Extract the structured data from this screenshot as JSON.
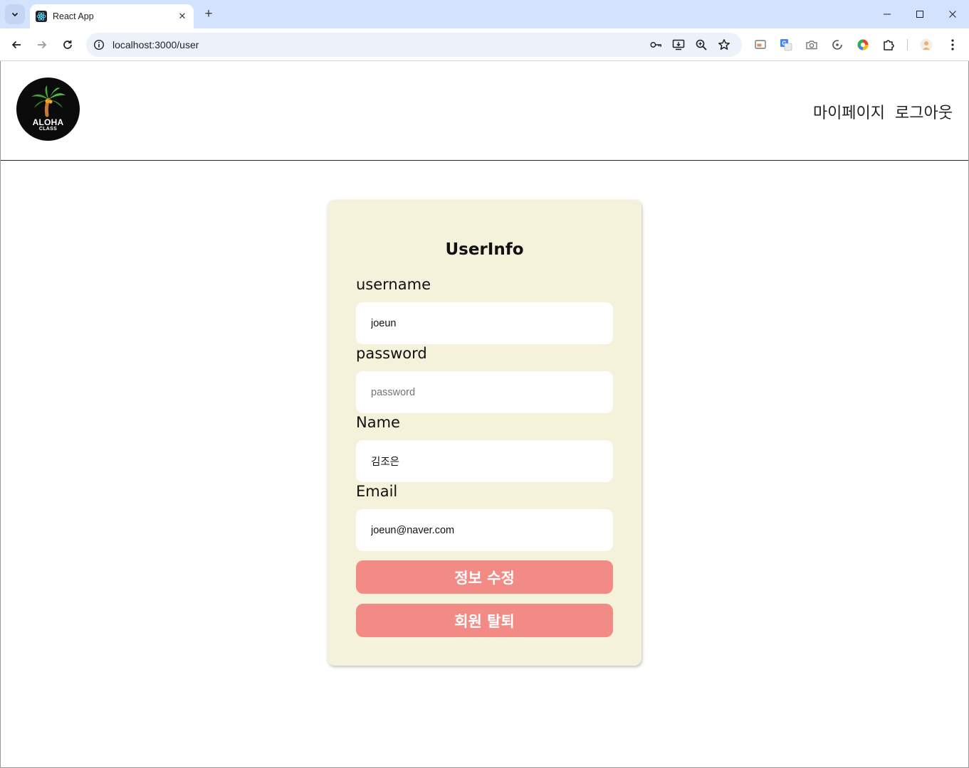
{
  "browser": {
    "tab_title": "React App",
    "tab_close": "✕",
    "new_tab": "+",
    "url": "localhost:3000/user"
  },
  "header": {
    "logo_text": "ALOHA",
    "logo_subtext": "CLASS",
    "nav": [
      {
        "label": "마이페이지"
      },
      {
        "label": "로그아웃"
      }
    ]
  },
  "form": {
    "title": "UserInfo",
    "fields": [
      {
        "label": "username",
        "value": "joeun",
        "placeholder": ""
      },
      {
        "label": "password",
        "value": "",
        "placeholder": "password"
      },
      {
        "label": "Name",
        "value": "김조은",
        "placeholder": ""
      },
      {
        "label": "Email",
        "value": "joeun@naver.com",
        "placeholder": ""
      }
    ],
    "update_button": "정보 수정",
    "delete_button": "회원 탈퇴"
  },
  "colors": {
    "card_background": "#f4f2da",
    "button_background": "#f28b85",
    "tabstrip": "#d3e3fd"
  }
}
